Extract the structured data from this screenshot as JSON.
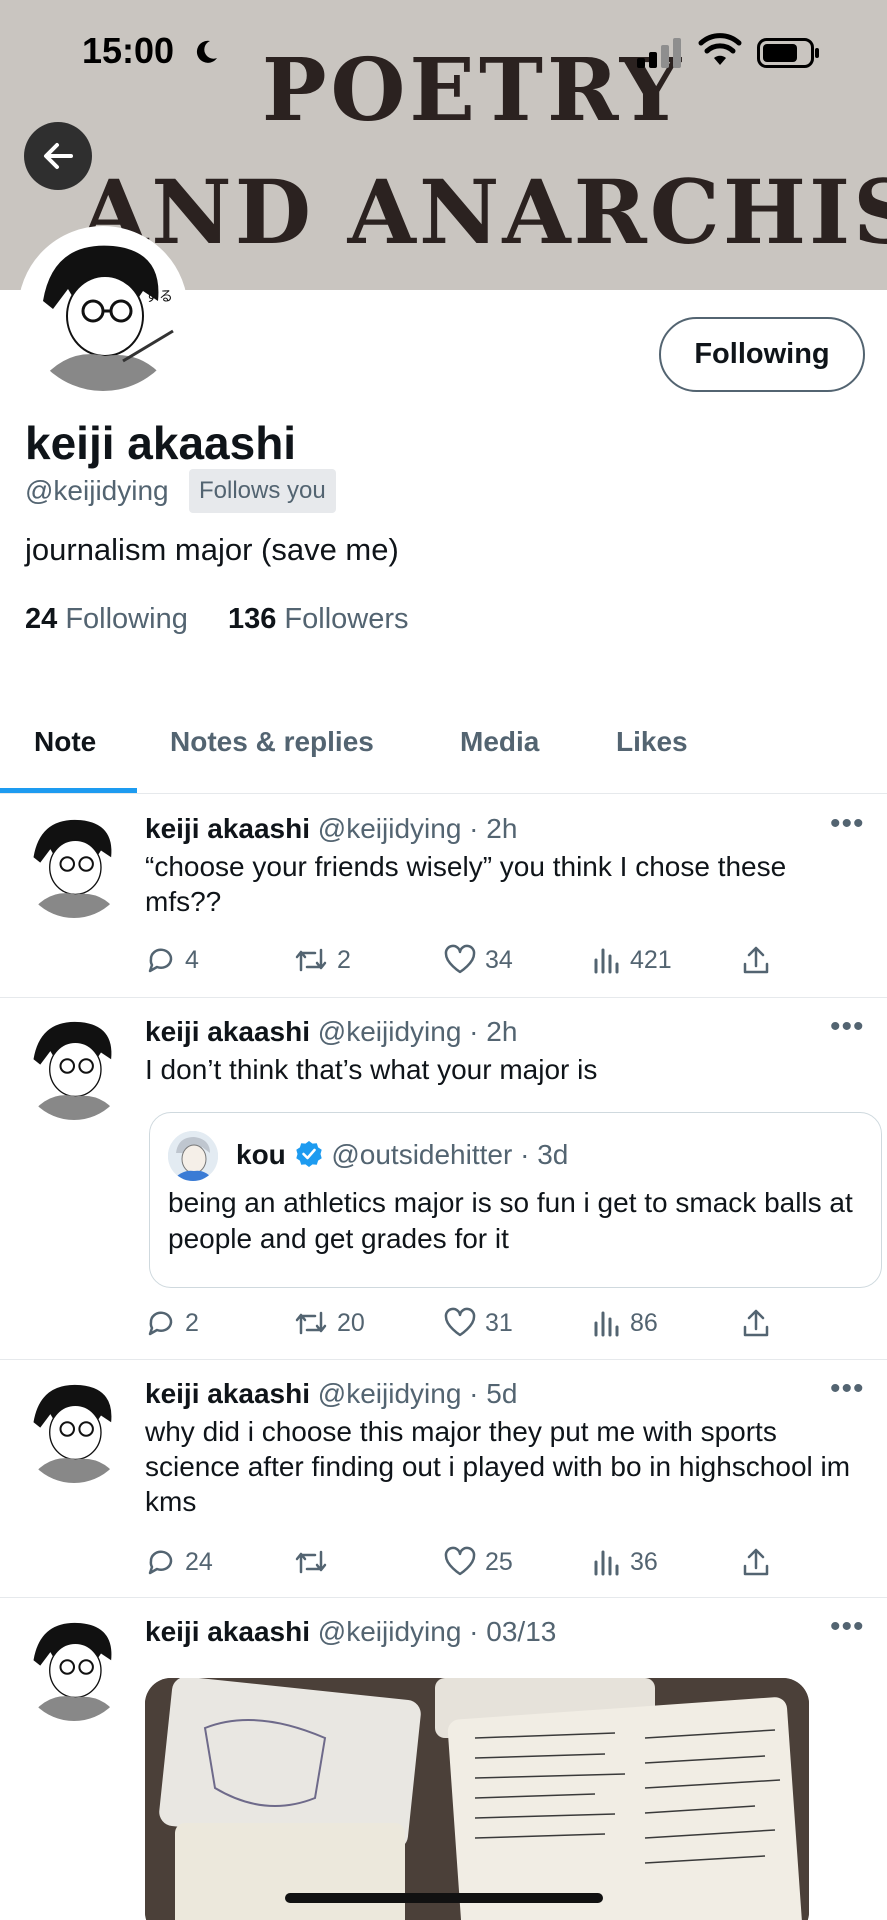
{
  "status": {
    "time": "15:00"
  },
  "banner": {
    "line1": "POETRY",
    "line2": "AND ANARCHISM"
  },
  "profile": {
    "name": "keiji akaashi",
    "handle": "@keijidying",
    "follows_you": "Follows you",
    "bio": "journalism major (save me)",
    "following_count": "24",
    "following_label": "Following",
    "followers_count": "136",
    "followers_label": "Followers",
    "follow_button": "Following"
  },
  "tabs": [
    "Note",
    "Notes & replies",
    "Media",
    "Likes"
  ],
  "posts": [
    {
      "name": "keiji akaashi",
      "meta": "@keijidying · 2h",
      "text": "“choose your friends wisely” you think I chose these mfs??",
      "replies": "4",
      "reposts": "2",
      "likes": "34",
      "views": "421"
    },
    {
      "name": "keiji akaashi",
      "meta": "@keijidying · 2h",
      "text": "I don’t think that’s what your major is",
      "quote": {
        "name": "kou",
        "meta": "@outsidehitter · 3d",
        "text": "being an athletics major is so fun i get to smack balls at people and get grades for it"
      },
      "replies": "2",
      "reposts": "20",
      "likes": "31",
      "views": "86"
    },
    {
      "name": "keiji akaashi",
      "meta": "@keijidying · 5d",
      "text": "why did i choose this major they put me with sports science after finding out i played with bo in highschool im kms",
      "replies": "24",
      "reposts": "",
      "likes": "25",
      "views": "36"
    },
    {
      "name": "keiji akaashi",
      "meta": "@keijidying · 03/13"
    }
  ],
  "colors": {
    "accent": "#1d9bf0",
    "muted": "#536471",
    "verified": "#1d9bf0"
  },
  "icons": [
    "back-arrow-icon",
    "moon-icon",
    "signal-icon",
    "wifi-icon",
    "battery-icon",
    "reply-icon",
    "repost-icon",
    "like-icon",
    "views-icon",
    "share-icon",
    "more-icon",
    "verified-icon"
  ]
}
